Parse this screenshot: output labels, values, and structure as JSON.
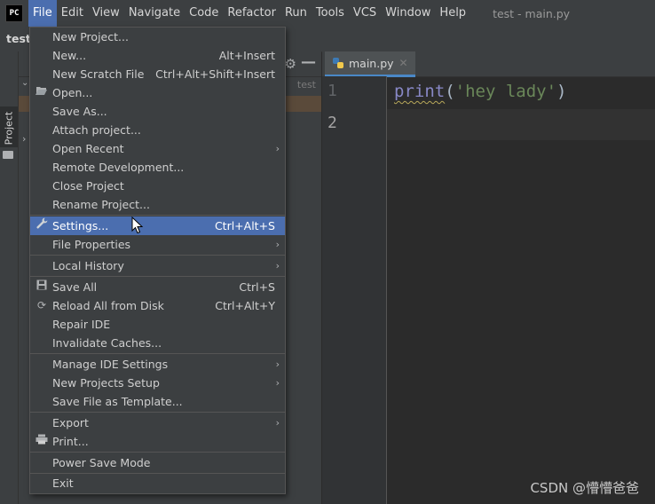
{
  "app": {
    "logo": "PC",
    "window_title": "test - main.py"
  },
  "menubar": {
    "items": [
      "File",
      "Edit",
      "View",
      "Navigate",
      "Code",
      "Refactor",
      "Run",
      "Tools",
      "VCS",
      "Window",
      "Help"
    ],
    "active": "File"
  },
  "navbar": {
    "project_name": "test"
  },
  "toolstrip": {
    "project_label": "Project"
  },
  "project_panel": {
    "path_hint": "test"
  },
  "editor": {
    "tab_label": "main.py",
    "line_numbers": [
      "1",
      "2"
    ],
    "code": {
      "fn": "print",
      "open": "(",
      "str": "'hey lady'",
      "close": ")"
    }
  },
  "file_menu": {
    "items": [
      {
        "label": "New Project...",
        "shortcut": ""
      },
      {
        "label": "New...",
        "shortcut": "Alt+Insert"
      },
      {
        "label": "New Scratch File",
        "shortcut": "Ctrl+Alt+Shift+Insert"
      },
      {
        "label": "Open...",
        "shortcut": "",
        "icon": "folder-open-icon"
      },
      {
        "label": "Save As...",
        "shortcut": ""
      },
      {
        "label": "Attach project...",
        "shortcut": ""
      },
      {
        "label": "Open Recent",
        "shortcut": "",
        "submenu": true
      },
      {
        "label": "Remote Development...",
        "shortcut": ""
      },
      {
        "label": "Close Project",
        "shortcut": ""
      },
      {
        "label": "Rename Project...",
        "shortcut": ""
      },
      {
        "label": "Settings...",
        "shortcut": "Ctrl+Alt+S",
        "icon": "wrench-icon",
        "selected": true
      },
      {
        "label": "File Properties",
        "shortcut": "",
        "submenu": true
      },
      {
        "label": "Local History",
        "shortcut": "",
        "submenu": true
      },
      {
        "label": "Save All",
        "shortcut": "Ctrl+S",
        "icon": "save-icon"
      },
      {
        "label": "Reload All from Disk",
        "shortcut": "Ctrl+Alt+Y",
        "icon": "reload-icon"
      },
      {
        "label": "Repair IDE",
        "shortcut": ""
      },
      {
        "label": "Invalidate Caches...",
        "shortcut": ""
      },
      {
        "label": "Manage IDE Settings",
        "shortcut": "",
        "submenu": true
      },
      {
        "label": "New Projects Setup",
        "shortcut": "",
        "submenu": true
      },
      {
        "label": "Save File as Template...",
        "shortcut": ""
      },
      {
        "label": "Export",
        "shortcut": "",
        "submenu": true
      },
      {
        "label": "Print...",
        "shortcut": "",
        "icon": "printer-icon"
      },
      {
        "label": "Power Save Mode",
        "shortcut": ""
      },
      {
        "label": "Exit",
        "shortcut": ""
      }
    ]
  },
  "watermark": "CSDN @懵懵爸爸",
  "colors": {
    "accent": "#4b6eaf",
    "menu_bg": "#3c3f41",
    "editor_bg": "#2b2b2b",
    "string": "#6a8759",
    "builtin": "#8888c6"
  }
}
